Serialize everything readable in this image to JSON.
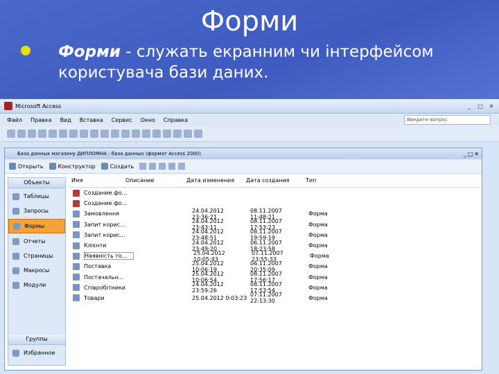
{
  "slide": {
    "title": "Форми",
    "bullet_bold": "Форми",
    "bullet_rest": " - служать екранним чи інтерфейсом",
    "bullet_line2": "користувача бази даних."
  },
  "app": {
    "title": "Microsoft Access",
    "menu": [
      "Файл",
      "Правка",
      "Вид",
      "Вставка",
      "Сервис",
      "Окно",
      "Справка"
    ],
    "help_placeholder": "Введите вопрос",
    "db_title": "База данных магазину ДИПЛОМНА : база данных (формат Access 2000)",
    "db_toolbar": {
      "open": "Открыть",
      "design": "Конструктор",
      "create": "Создать"
    },
    "sidebar": {
      "objects_header": "Объекты",
      "items": [
        "Таблицы",
        "Запросы",
        "Формы",
        "Отчеты",
        "Страницы",
        "Макросы",
        "Модули"
      ],
      "active_index": 2,
      "groups_header": "Группы",
      "group_items": [
        "Избранное"
      ]
    },
    "columns": [
      "Имя",
      "Описание",
      "Дата изменения",
      "Дата создания",
      "Тип"
    ],
    "rows": [
      {
        "name": "Создание фо...",
        "desc": "",
        "mod": "",
        "cre": "",
        "type": "",
        "new": true
      },
      {
        "name": "Создание фо...",
        "desc": "",
        "mod": "",
        "cre": "",
        "type": "",
        "new": true
      },
      {
        "name": "Замовлення",
        "desc": "",
        "mod": "24.04.2012 23:36:21",
        "cre": "08.11.2007 11:48:21",
        "type": "Форма"
      },
      {
        "name": "Запит корис...",
        "desc": "",
        "mod": "24.04.2012 23:43:11",
        "cre": "08.11.2007 17:53:23",
        "type": "Форма"
      },
      {
        "name": "Запит корис...",
        "desc": "",
        "mod": "24.04.2012 23:48:51",
        "cre": "08.11.2007 19:59:19",
        "type": "Форма"
      },
      {
        "name": "Клієнти",
        "desc": "",
        "mod": "24.04.2012 23:49:20",
        "cre": "06.11.2007 18:23:58",
        "type": "Форма"
      },
      {
        "name": "Наявність то...",
        "desc": "",
        "mod": "25.04.2012 10:05:43",
        "cre": "07.11.2007 23:55:33",
        "type": "Форма"
      },
      {
        "name": "Поставка",
        "desc": "",
        "mod": "25.04.2012 10:06:19",
        "cre": "06.11.2007 20:35:09",
        "type": "Форма"
      },
      {
        "name": "Постачальн...",
        "desc": "",
        "mod": "25.04.2012 10:06:54",
        "cre": "08.11.2007 17:56:17",
        "type": "Форма"
      },
      {
        "name": "Співробітники",
        "desc": "",
        "mod": "24.04.2012 23:59:26",
        "cre": "08.11.2007 17:53:54",
        "type": "Форма"
      },
      {
        "name": "Товари",
        "desc": "",
        "mod": "25.04.2012 0:03:23",
        "cre": "07.11.2007 22:13:30",
        "type": "Форма"
      }
    ]
  }
}
